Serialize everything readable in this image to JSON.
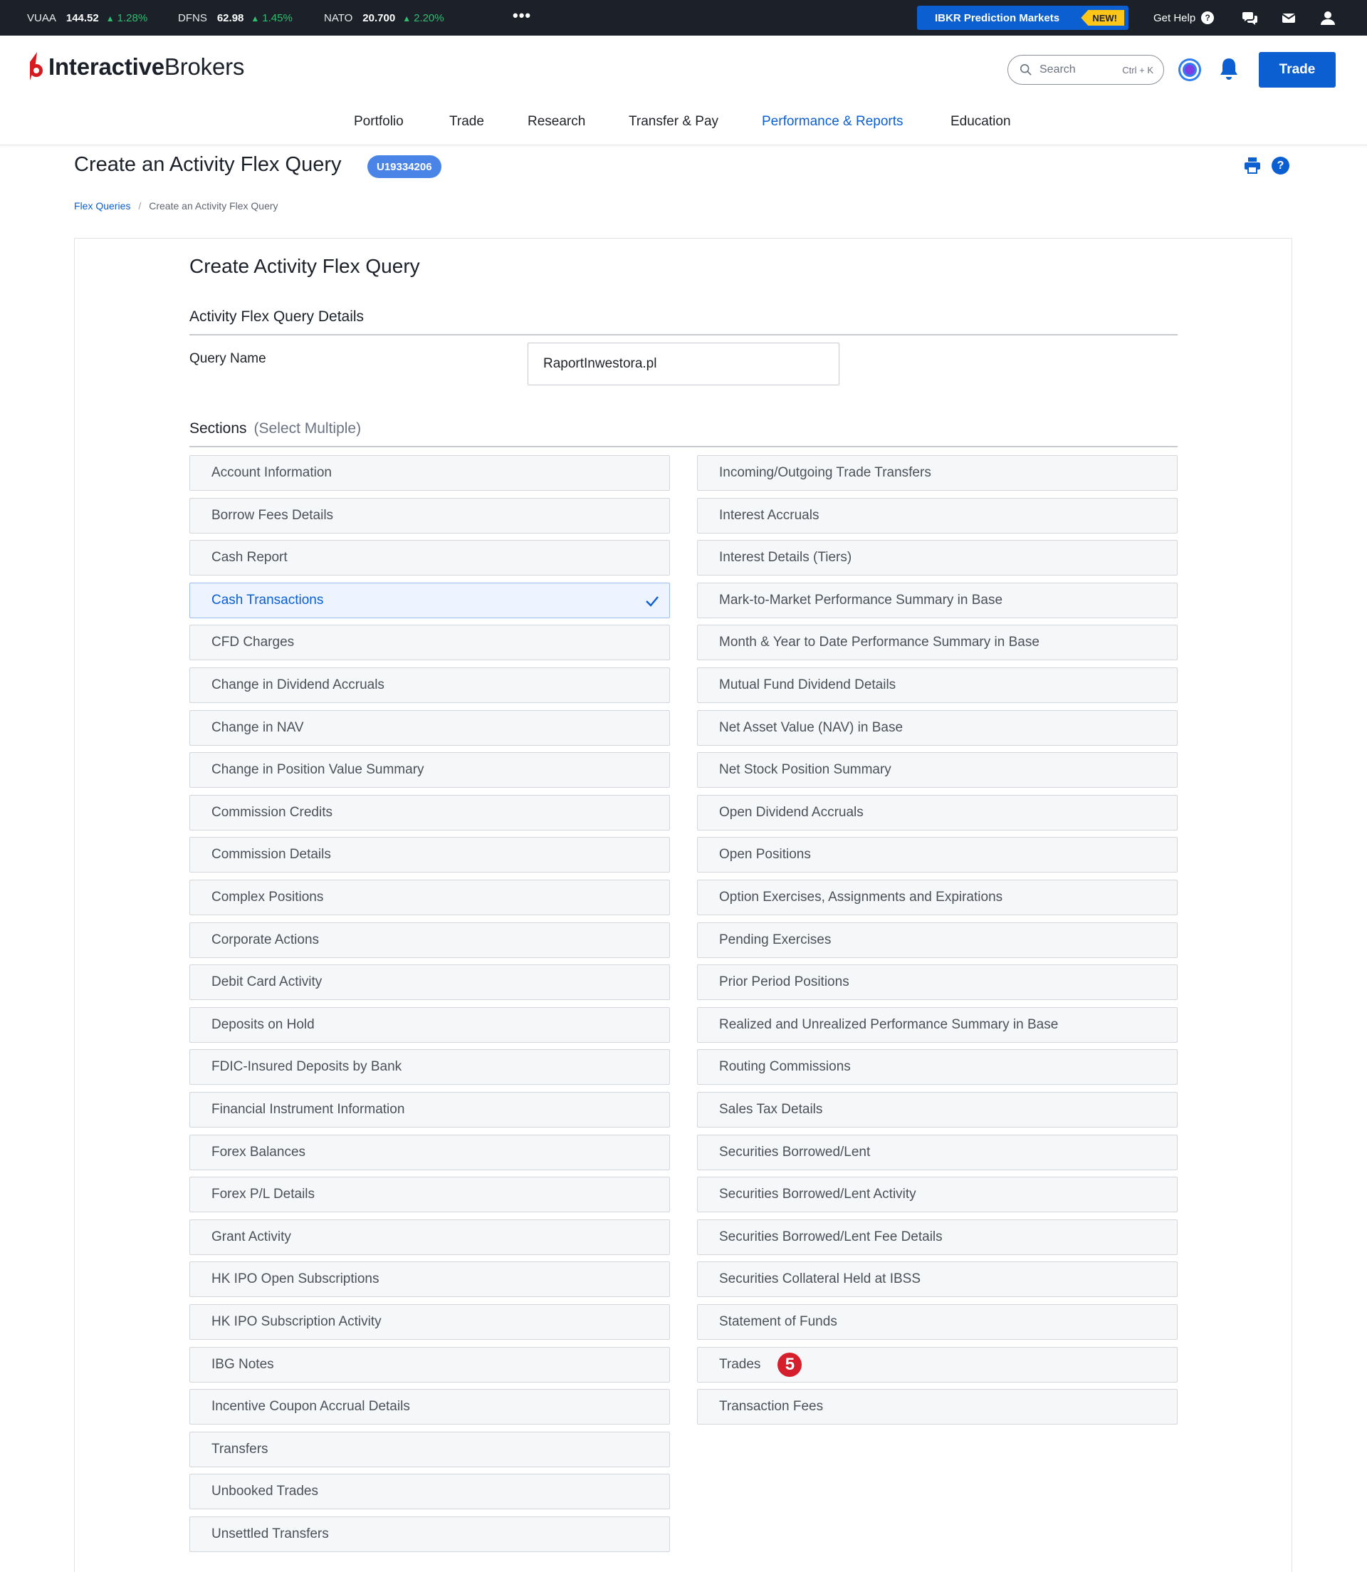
{
  "ticker": [
    {
      "symbol": "VUAA",
      "price": "144.52",
      "change": "1.28%"
    },
    {
      "symbol": "DFNS",
      "price": "62.98",
      "change": "1.45%"
    },
    {
      "symbol": "NATO",
      "price": "20.700",
      "change": "2.20%"
    }
  ],
  "top_bar": {
    "more": "•••",
    "prediction_label": "IBKR Prediction Markets",
    "new_badge": "NEW!",
    "get_help": "Get Help",
    "help_glyph": "?"
  },
  "header": {
    "logo_bold": "Interactive",
    "logo_regular": "Brokers",
    "search_placeholder": "Search",
    "search_shortcut": "Ctrl + K",
    "trade_button": "Trade"
  },
  "nav": [
    "Portfolio",
    "Trade",
    "Research",
    "Transfer & Pay",
    "Performance & Reports",
    "Education"
  ],
  "nav_active": "Performance & Reports",
  "page": {
    "title": "Create an Activity Flex Query",
    "account_id": "U19334206",
    "help_glyph": "?",
    "breadcrumb": {
      "parent": "Flex Queries",
      "separator": "/",
      "current": "Create an Activity Flex Query"
    }
  },
  "form": {
    "title": "Create Activity Flex Query",
    "details_heading": "Activity Flex Query Details",
    "query_name_label": "Query Name",
    "query_name_value": "RaportInwestora.pl",
    "sections_heading": "Sections",
    "sections_hint": "(Select Multiple)"
  },
  "sections_left": [
    "Account Information",
    "Borrow Fees Details",
    "Cash Report",
    "Cash Transactions",
    "CFD Charges",
    "Change in Dividend Accruals",
    "Change in NAV",
    "Change in Position Value Summary",
    "Commission Credits",
    "Commission Details",
    "Complex Positions",
    "Corporate Actions",
    "Debit Card Activity",
    "Deposits on Hold",
    "FDIC-Insured Deposits by Bank",
    "Financial Instrument Information",
    "Forex Balances",
    "Forex P/L Details",
    "Grant Activity",
    "HK IPO Open Subscriptions",
    "HK IPO Subscription Activity",
    "IBG Notes",
    "Incentive Coupon Accrual Details",
    "Transfers",
    "Unbooked Trades",
    "Unsettled Transfers"
  ],
  "sections_right": [
    "Incoming/Outgoing Trade Transfers",
    "Interest Accruals",
    "Interest Details (Tiers)",
    "Mark-to-Market Performance Summary in Base",
    "Month & Year to Date Performance Summary in Base",
    "Mutual Fund Dividend Details",
    "Net Asset Value (NAV) in Base",
    "Net Stock Position Summary",
    "Open Dividend Accruals",
    "Open Positions",
    "Option Exercises, Assignments and Expirations",
    "Pending Exercises",
    "Prior Period Positions",
    "Realized and Unrealized Performance Summary in Base",
    "Routing Commissions",
    "Sales Tax Details",
    "Securities Borrowed/Lent",
    "Securities Borrowed/Lent Activity",
    "Securities Borrowed/Lent Fee Details",
    "Securities Collateral Held at IBSS",
    "Statement of Funds",
    "Trades",
    "Transaction Fees"
  ],
  "selected_sections": [
    "Cash Transactions"
  ],
  "annotation": {
    "section": "Trades",
    "label": "5"
  },
  "colors": {
    "accent": "#0b5fd1",
    "positive": "#2fbf71",
    "new_badge": "#ffc61a",
    "annotation": "#d61f2c",
    "topbar": "#1b2029"
  }
}
